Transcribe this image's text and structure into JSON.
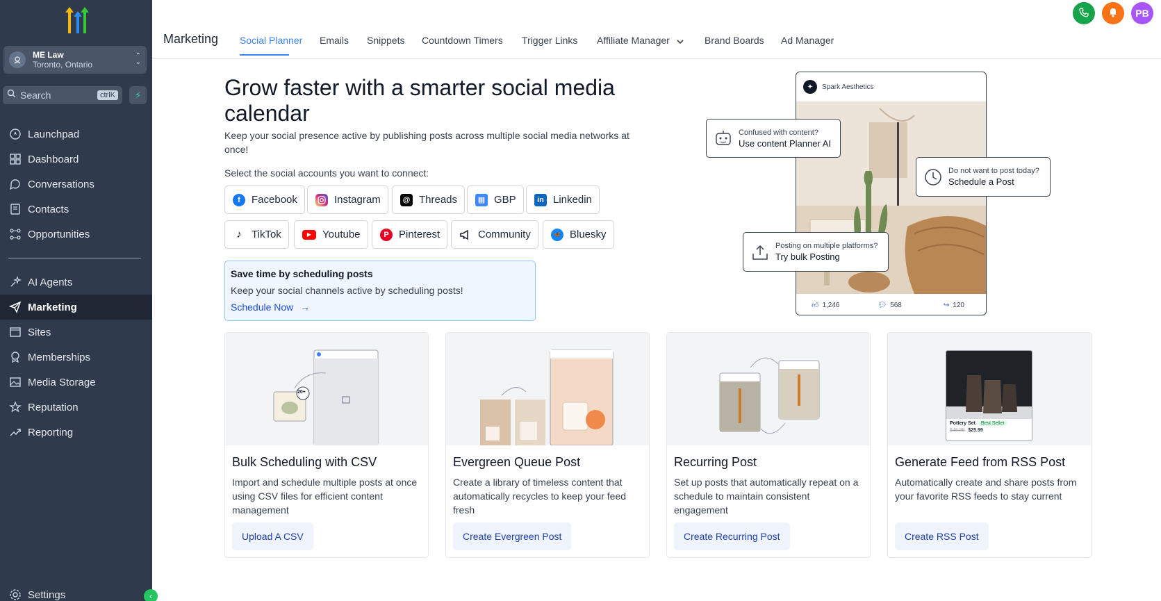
{
  "sidebar": {
    "account": {
      "name": "ME Law",
      "location": "Toronto, Ontario"
    },
    "search": {
      "placeholder": "Search",
      "shortcut": "ctrlK"
    },
    "items": [
      {
        "label": "Launchpad",
        "icon": "rocket-icon"
      },
      {
        "label": "Dashboard",
        "icon": "grid-icon"
      },
      {
        "label": "Conversations",
        "icon": "chat-icon"
      },
      {
        "label": "Contacts",
        "icon": "contacts-icon"
      },
      {
        "label": "Opportunities",
        "icon": "pipeline-icon"
      },
      {
        "label": "AI Agents",
        "icon": "sparkle-icon"
      },
      {
        "label": "Marketing",
        "icon": "paper-plane-icon",
        "active": true
      },
      {
        "label": "Sites",
        "icon": "browser-icon"
      },
      {
        "label": "Memberships",
        "icon": "badge-icon"
      },
      {
        "label": "Media Storage",
        "icon": "image-icon"
      },
      {
        "label": "Reputation",
        "icon": "star-icon"
      },
      {
        "label": "Reporting",
        "icon": "trend-icon"
      },
      {
        "label": "Settings",
        "icon": "gear-icon"
      }
    ]
  },
  "header": {
    "title": "Marketing",
    "tabs": [
      {
        "label": "Social Planner",
        "active": true
      },
      {
        "label": "Emails"
      },
      {
        "label": "Snippets"
      },
      {
        "label": "Countdown Timers"
      },
      {
        "label": "Trigger Links"
      },
      {
        "label": "Affiliate Manager"
      },
      {
        "label": "Brand Boards"
      },
      {
        "label": "Ad Manager"
      }
    ],
    "avatar_initials": "PB"
  },
  "hero": {
    "title": "Grow faster with a smarter social media calendar",
    "subtitle": "Keep your social presence active by publishing posts across multiple social media networks at once!",
    "select_label": "Select the social accounts you want to connect:",
    "accounts": [
      {
        "label": "Facebook",
        "color": "#1877f2"
      },
      {
        "label": "Instagram",
        "color": "#d62976"
      },
      {
        "label": "Threads",
        "color": "#000000"
      },
      {
        "label": "GBP",
        "color": "#4285f4"
      },
      {
        "label": "Linkedin",
        "color": "#0a66c2"
      },
      {
        "label": "TikTok",
        "color": "#000000"
      },
      {
        "label": "Youtube",
        "color": "#ff0000"
      },
      {
        "label": "Pinterest",
        "color": "#e60023"
      },
      {
        "label": "Community",
        "color": "#111827"
      },
      {
        "label": "Bluesky",
        "color": "#1185fe"
      }
    ],
    "schedule_box": {
      "title": "Save time by scheduling posts",
      "description": "Keep your social channels active by scheduling posts!",
      "link": "Schedule Now"
    }
  },
  "mockup": {
    "brand": "Spark Aesthetics",
    "likes": "1,246",
    "comments": "568",
    "shares": "120",
    "callouts": [
      {
        "small": "Confused with content?",
        "big": "Use content Planner AI"
      },
      {
        "small": "Do not want to post today?",
        "big": "Schedule a Post"
      },
      {
        "small": "Posting on multiple platforms?",
        "big": "Try bulk Posting"
      }
    ]
  },
  "cards": [
    {
      "title": "Bulk Scheduling with CSV",
      "description": "Import and schedule multiple posts at once using CSV files for efficient content management",
      "button": "Upload A CSV",
      "badge": "20+"
    },
    {
      "title": "Evergreen Queue Post",
      "description": "Create a library of timeless content that automatically recycles to keep your feed fresh",
      "button": "Create Evergreen Post"
    },
    {
      "title": "Recurring Post",
      "description": "Set up posts that automatically repeat on a schedule to maintain consistent engagement",
      "button": "Create Recurring Post"
    },
    {
      "title": "Generate Feed from RSS Post",
      "description": "Automatically create and share posts from your favorite RSS feeds to stay current",
      "button": "Create RSS Post",
      "product": {
        "name": "Pottery Set",
        "tag": "Best Seller",
        "old_price": "$49.99",
        "price": "$25.99"
      }
    }
  ],
  "colors": {
    "sidebar_bg": "#2f3b4c",
    "accent": "#3b82f6",
    "phone_btn": "#16a34a",
    "bell_btn": "#f97316",
    "avatar": "#a855f7"
  }
}
